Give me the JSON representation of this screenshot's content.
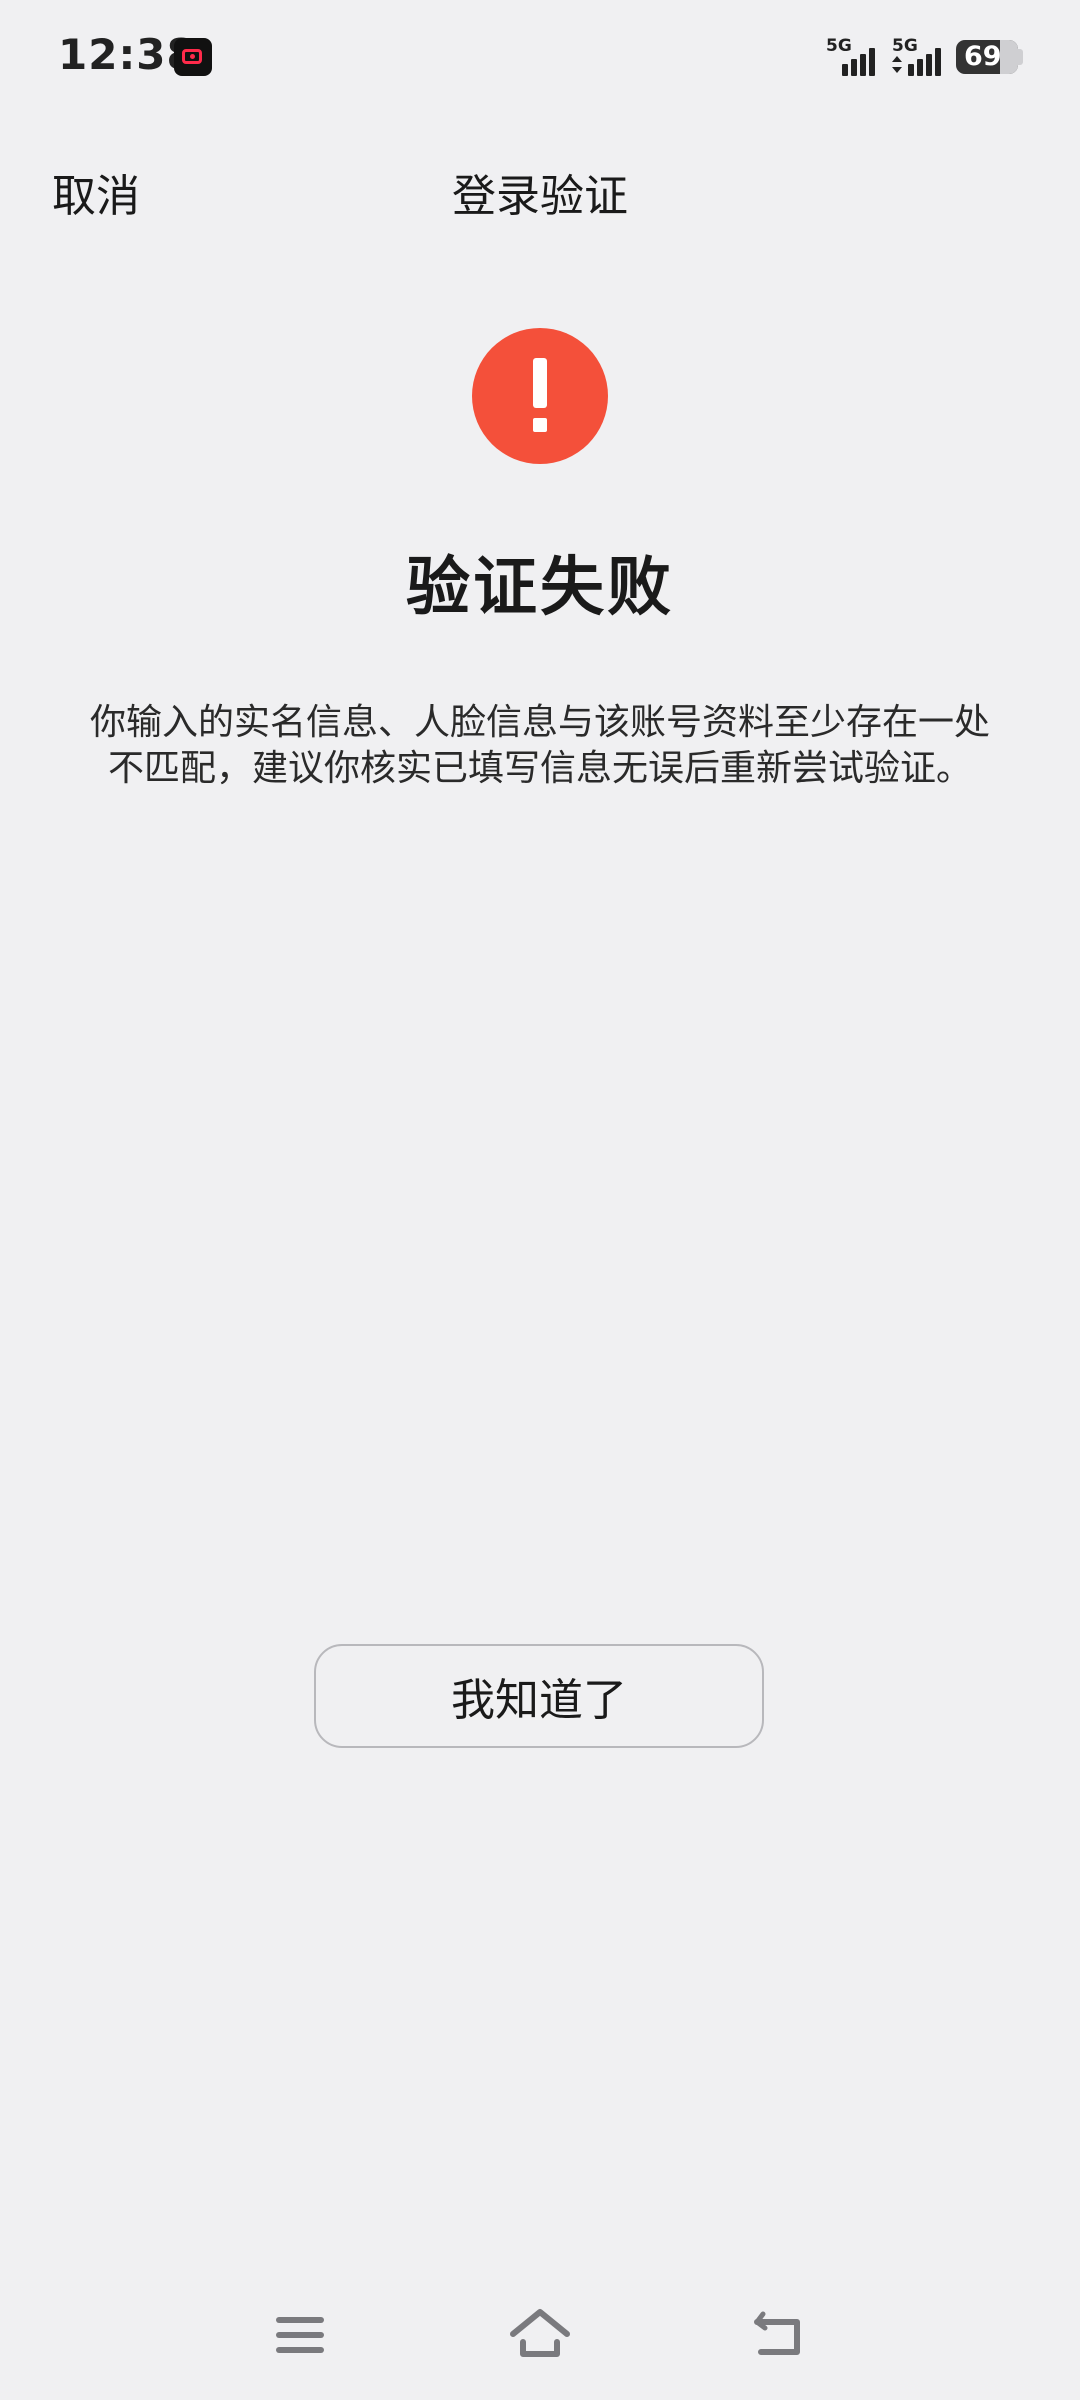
{
  "status_bar": {
    "time": "12:38",
    "recorder_icon": "screen-recorder-icon",
    "sim1_network": "5G",
    "sim2_network": "5G",
    "battery_level": "69"
  },
  "header": {
    "cancel_label": "取消",
    "title": "登录验证"
  },
  "result": {
    "icon": "exclamation-icon",
    "icon_color": "#f4503a",
    "title": "验证失败",
    "message": "你输入的实名信息、人脸信息与该账号资料至少存在一处不匹配，建议你核实已填写信息无误后重新尝试验证。"
  },
  "actions": {
    "ok_label": "我知道了"
  },
  "nav_bar": {
    "menu_icon": "menu-icon",
    "home_icon": "home-icon",
    "back_icon": "back-icon"
  }
}
